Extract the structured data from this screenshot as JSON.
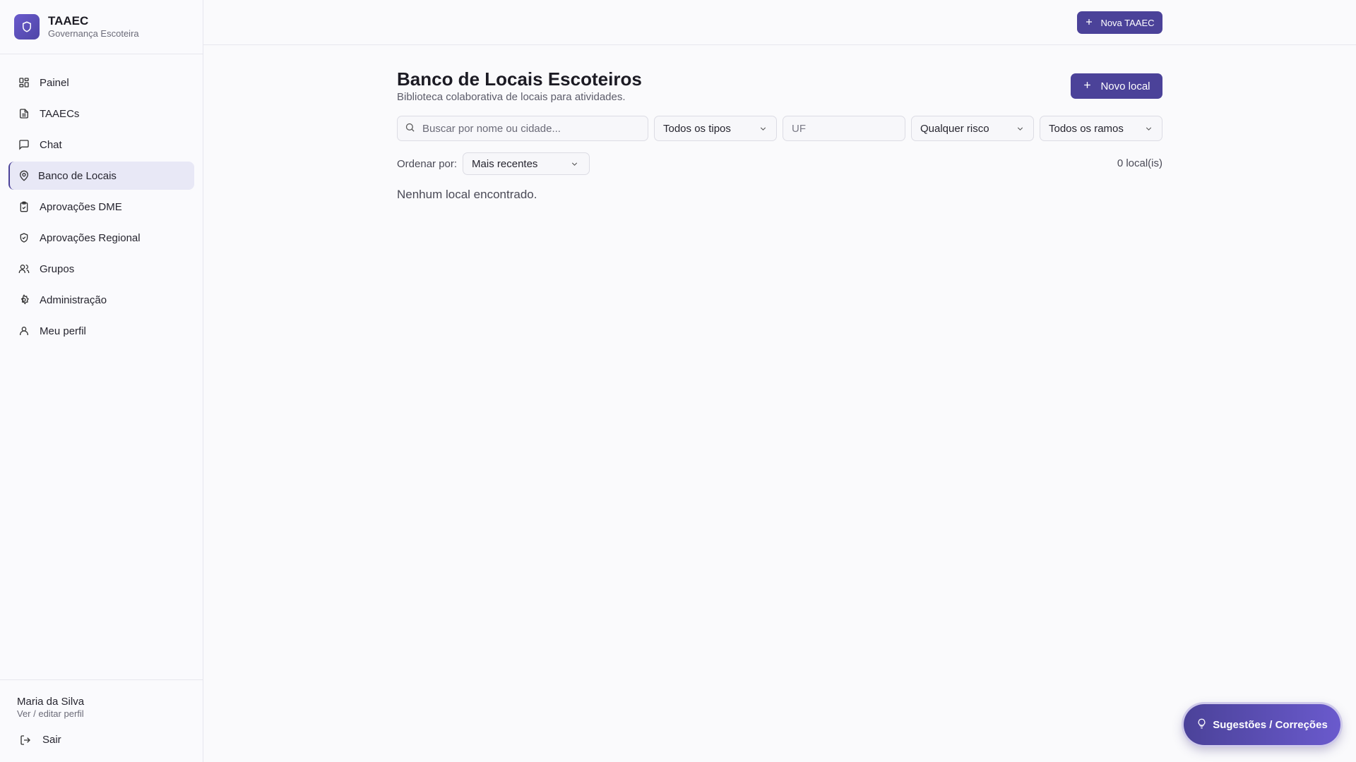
{
  "brand": {
    "title": "TAAEC",
    "subtitle": "Governança Escoteira"
  },
  "sidebar": {
    "items": [
      {
        "label": "Painel",
        "icon": "dashboard-icon"
      },
      {
        "label": "TAAECs",
        "icon": "document-icon"
      },
      {
        "label": "Chat",
        "icon": "chat-icon"
      },
      {
        "label": "Banco de Locais",
        "icon": "map-pin-icon",
        "active": true
      },
      {
        "label": "Aprovações DME",
        "icon": "clipboard-check-icon"
      },
      {
        "label": "Aprovações Regional",
        "icon": "shield-check-icon"
      },
      {
        "label": "Grupos",
        "icon": "users-icon"
      },
      {
        "label": "Administração",
        "icon": "gear-icon"
      },
      {
        "label": "Meu perfil",
        "icon": "user-icon"
      }
    ],
    "user": {
      "name": "Maria da Silva",
      "link": "Ver / editar perfil"
    },
    "logout_label": "Sair"
  },
  "header": {
    "new_taaec_label": "Nova TAAEC"
  },
  "main": {
    "title": "Banco de Locais Escoteiros",
    "subtitle": "Biblioteca colaborativa de locais para atividades.",
    "new_local_label": "Novo local",
    "filters": {
      "search_placeholder": "Buscar por nome ou cidade...",
      "tipo_selected": "Todos os tipos",
      "uf_placeholder": "UF",
      "risco_selected": "Qualquer risco",
      "ramo_selected": "Todos os ramos"
    },
    "sort": {
      "label": "Ordenar por:",
      "selected": "Mais recentes"
    },
    "count_text": "0 local(is)",
    "empty_text": "Nenhum local encontrado."
  },
  "fab": {
    "label": "Sugestões / Correções"
  },
  "colors": {
    "accent": "#4b4299",
    "active_bg": "#e8e8f6"
  }
}
